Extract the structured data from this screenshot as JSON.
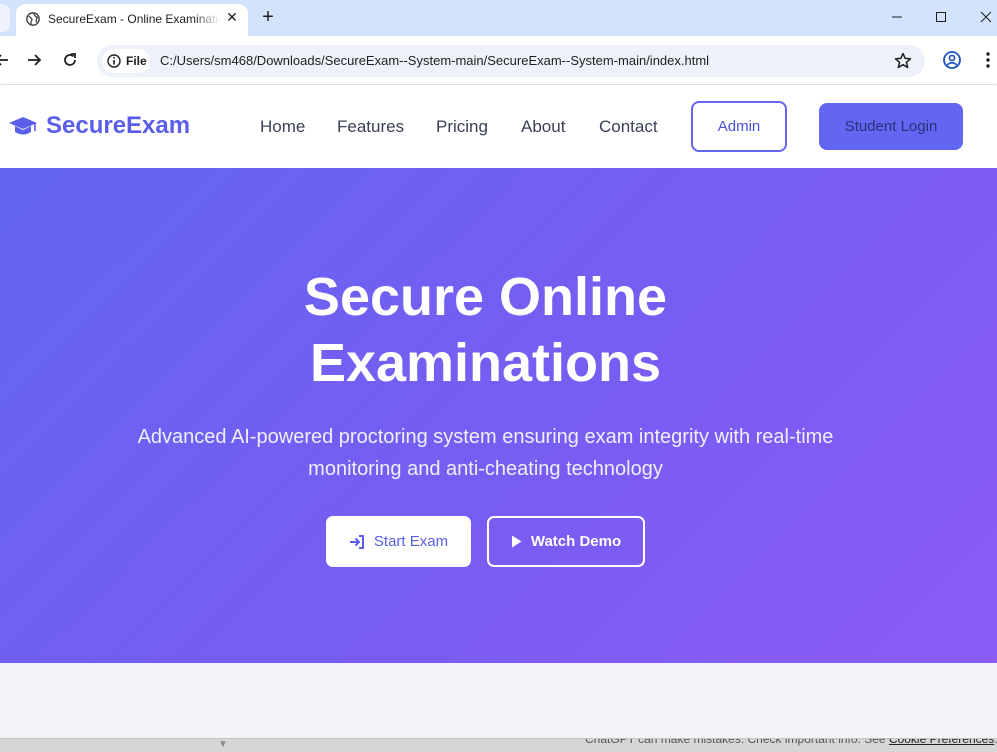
{
  "browser": {
    "tab_title": "SecureExam - Online Examination",
    "tab_close": "✕",
    "new_tab": "+",
    "url_chip": "File",
    "url": "C:/Users/sm468/Downloads/SecureExam--System-main/SecureExam--System-main/index.html"
  },
  "site": {
    "brand": "SecureExam",
    "nav": {
      "home": "Home",
      "features": "Features",
      "pricing": "Pricing",
      "about": "About",
      "contact": "Contact"
    },
    "admin_button": "Admin",
    "student_login_button": "Student Login",
    "accent_color": "#6366f1"
  },
  "hero": {
    "title_line1": "Secure Online",
    "title_line2": "Examinations",
    "subtitle": "Advanced AI-powered proctoring system ensuring exam integrity with real-time monitoring and anti-cheating technology",
    "start_exam": "Start Exam",
    "watch_demo": "Watch Demo",
    "gradient_from": "#6366f1",
    "gradient_to": "#8b5cf6"
  },
  "footer_strip": {
    "text": "ChatGPT can make mistakes. Check important info. See ",
    "link": "Cookie Preferences",
    "suffix": "."
  }
}
